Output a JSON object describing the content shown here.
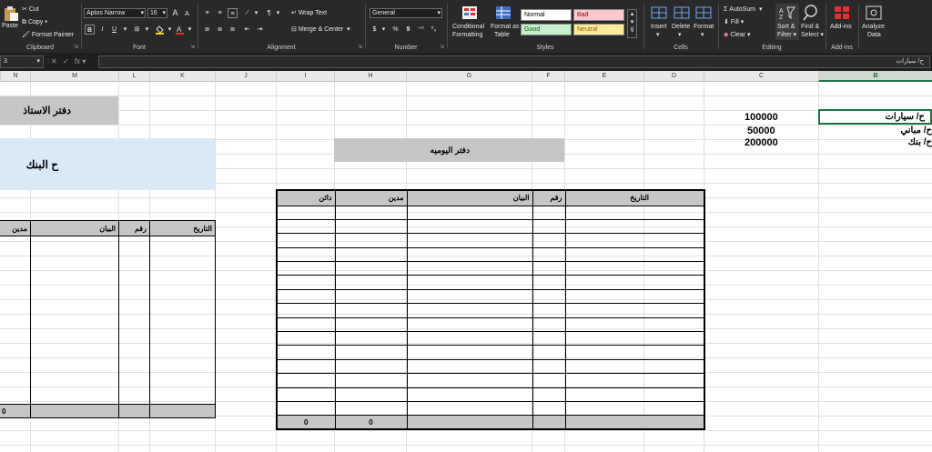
{
  "ribbon": {
    "clipboard": {
      "paste": "Paste",
      "cut": "Cut",
      "copy": "Copy",
      "format_painter": "Format Painter",
      "label": "Clipboard"
    },
    "font": {
      "name": "Aptos Narrow",
      "size": "16",
      "grow": "A",
      "shrink": "A",
      "bold": "B",
      "italic": "I",
      "underline": "U",
      "label": "Font"
    },
    "alignment": {
      "wrap": "Wrap Text",
      "merge": "Merge & Center",
      "label": "Alignment"
    },
    "number": {
      "format": "General",
      "currency": "$",
      "percent": "%",
      "comma": "9",
      "label": "Number"
    },
    "styles": {
      "conditional": "Conditional",
      "conditional2": "Formatting",
      "format_table": "Format as",
      "format_table2": "Table",
      "normal": "Normal",
      "bad": "Bad",
      "good": "Good",
      "neutral": "Neutral",
      "label": "Styles"
    },
    "cells": {
      "insert": "Insert",
      "delete": "Delete",
      "format": "Format",
      "label": "Cells"
    },
    "editing": {
      "autosum": "AutoSum",
      "fill": "Fill",
      "clear": "Clear",
      "sort": "Sort &",
      "sort2": "Filter",
      "find": "Find &",
      "find2": "Select",
      "label": "Editing"
    },
    "addins": {
      "addins": "Add-ins",
      "label": "Add-ins"
    },
    "analyze": {
      "line1": "Analyze",
      "line2": "Data"
    }
  },
  "formula_bar": {
    "name_box": "3",
    "fx": "fx",
    "content": "ح/ سيارات"
  },
  "columns": [
    "N",
    "M",
    "L",
    "K",
    "J",
    "I",
    "H",
    "G",
    "F",
    "E",
    "D",
    "C",
    "B"
  ],
  "selected_column": "B",
  "sheet": {
    "ledger_title": "دفتر الاستاذ",
    "bank_title": "ح البنك",
    "journal_title": "دفتر اليوميه",
    "accounts": [
      {
        "name": "ح/ سيارات",
        "value": "100000"
      },
      {
        "name": "ح/ مباني",
        "value": "50000"
      },
      {
        "name": "ح/ بنك",
        "value": "200000"
      }
    ],
    "journal_headers": {
      "date": "التاريخ",
      "num": "رقم",
      "desc": "البيان",
      "debit": "مدين",
      "credit": "دائن"
    },
    "journal_totals": {
      "credit": "0",
      "debit": "0"
    },
    "ledger_headers": {
      "date": "التاريخ",
      "num": "رقم",
      "desc": "البيان",
      "debit": "مدين"
    },
    "ledger_total": "0"
  },
  "colors": {
    "ribbon_bg": "#292929",
    "grey_fill": "#c6c6c6",
    "blue_fill": "#dae9f8",
    "accent_green": "#217346"
  }
}
